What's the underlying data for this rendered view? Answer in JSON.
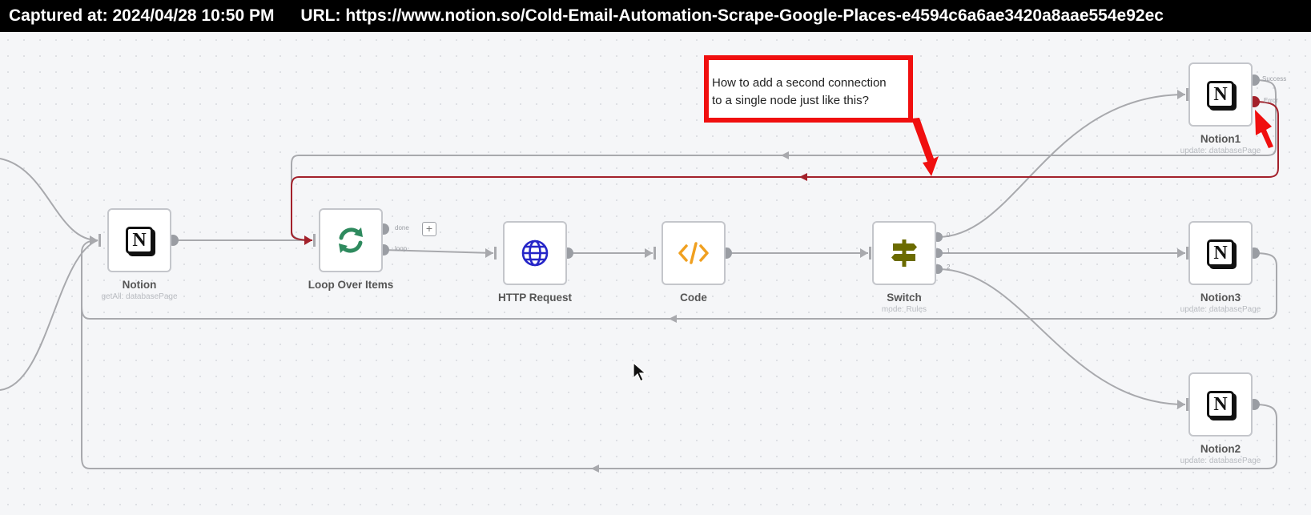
{
  "capture_bar": {
    "captured_label": "Captured at: 2024/04/28 10:50 PM",
    "url_label": "URL: https://www.notion.so/Cold-Email-Automation-Scrape-Google-Places-e4594c6a6ae3420a8aae554e92ec"
  },
  "callout": {
    "line1": "How to add a second connection",
    "line2": "to a single node just like this?"
  },
  "nodes": {
    "notion": {
      "title": "Notion",
      "subtitle": "getAll: databasePage",
      "logo_letter": "N"
    },
    "loop": {
      "title": "Loop Over Items",
      "port_done": "done",
      "port_loop": "loop"
    },
    "http": {
      "title": "HTTP Request"
    },
    "code": {
      "title": "Code"
    },
    "switch": {
      "title": "Switch",
      "subtitle": "mode: Rules",
      "port_0": "0",
      "port_1": "1",
      "port_2": "2"
    },
    "notion1": {
      "title": "Notion1",
      "subtitle": "update: databasePage",
      "logo_letter": "N",
      "port_success": "Success",
      "port_error": "Error"
    },
    "notion3": {
      "title": "Notion3",
      "subtitle": "update: databasePage",
      "logo_letter": "N"
    },
    "notion2": {
      "title": "Notion2",
      "subtitle": "update: databasePage",
      "logo_letter": "N"
    }
  },
  "colors": {
    "wire": "#a8a9ad",
    "error_wire": "#a3212b",
    "callout_border": "#f00f0f",
    "loop_icon": "#2e8a5e",
    "http_icon": "#2525c8",
    "code_icon": "#f0a020",
    "switch_icon": "#6b6b00"
  }
}
